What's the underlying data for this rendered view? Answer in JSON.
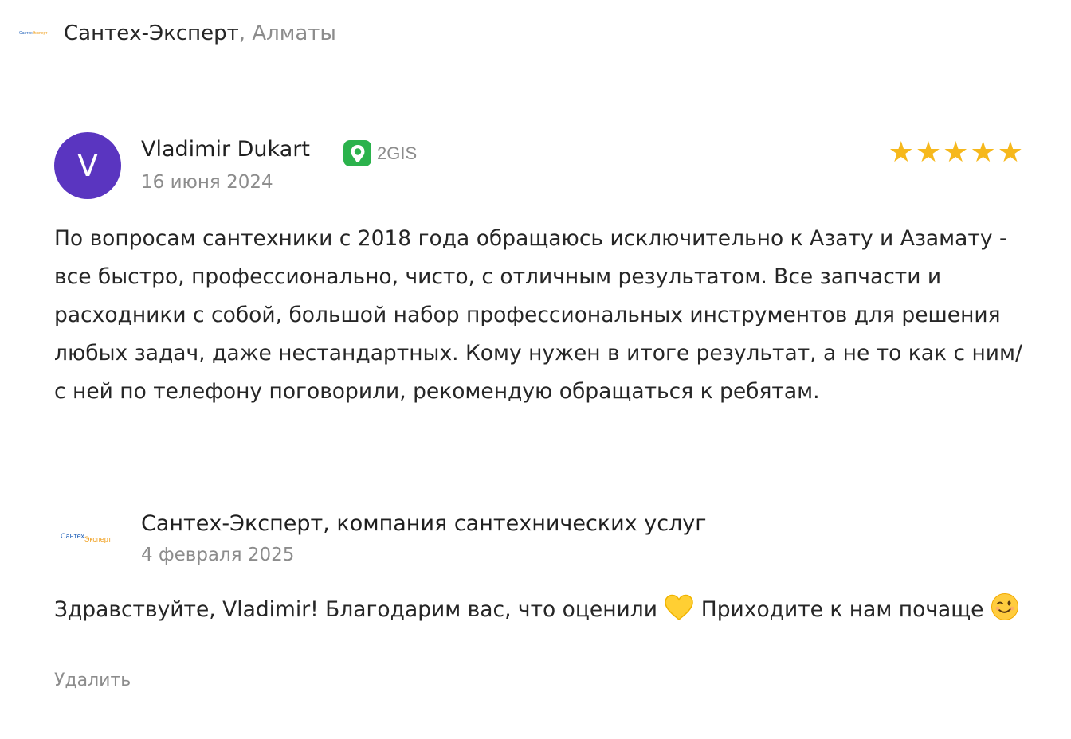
{
  "header": {
    "logo_part1": "Сантех",
    "logo_part2": "Эксперт",
    "company_name": "Сантех-Эксперт",
    "city": ", Алматы"
  },
  "review": {
    "avatar_letter": "V",
    "avatar_color": "#5a35c0",
    "author": "Vladimir Dukart",
    "source": "2GIS",
    "source_icon": "2gis-pin-icon",
    "source_color": "#2bb24c",
    "date": "16 июня 2024",
    "rating": 5,
    "rating_max": 5,
    "star_color": "#f6b81c",
    "text": "По вопросам сантехники с 2018 года обращаюсь исключительно к Азату и Азамату - все быстро, профессионально, чисто, с отличным результатом. Все запчасти и расходники с собой, большой набор профессиональных инструментов для решения любых задач, даже нестандартных. Кому нужен в итоге результат, а не то как с ним/с ней по телефону поговорили, рекомендую обращаться к ребятам."
  },
  "reply": {
    "logo_part1": "Сантех",
    "logo_part2": "Эксперт",
    "company": "Сантех-Эксперт, компания сантехнических услуг",
    "date": "4 февраля 2025",
    "text_part1": "Здравствуйте, Vladimir! Благодарим вас, что оценили",
    "emoji1": "yellow-heart-emoji",
    "text_part2": "Приходите к нам почаще",
    "emoji2": "winking-face-emoji",
    "delete_label": "Удалить"
  }
}
